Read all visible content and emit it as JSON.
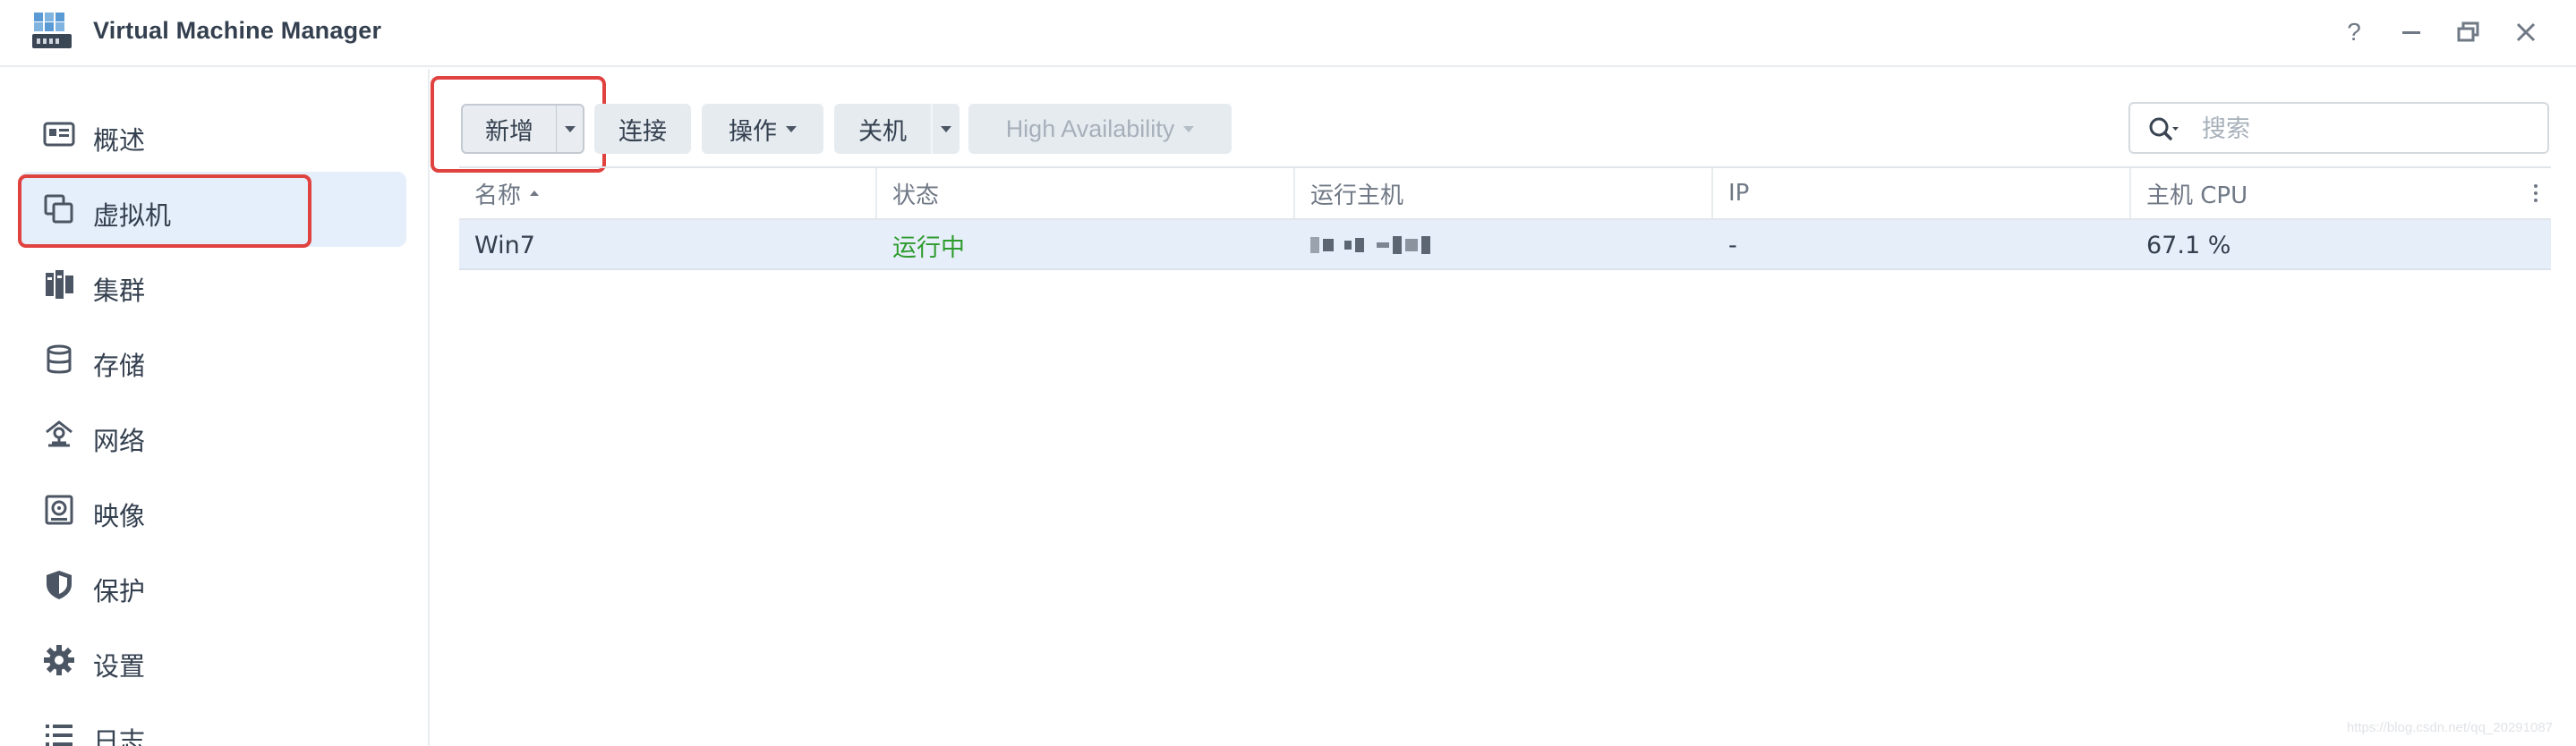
{
  "app": {
    "title": "Virtual Machine Manager",
    "window_buttons": [
      "?",
      "–",
      "❐",
      "✕"
    ]
  },
  "sidebar": {
    "items": [
      {
        "label": "概述",
        "icon": "overview-icon"
      },
      {
        "label": "虚拟机",
        "icon": "virtual-machine-icon",
        "active": true
      },
      {
        "label": "集群",
        "icon": "cluster-icon"
      },
      {
        "label": "存储",
        "icon": "storage-icon"
      },
      {
        "label": "网络",
        "icon": "network-icon"
      },
      {
        "label": "映像",
        "icon": "image-icon"
      },
      {
        "label": "保护",
        "icon": "shield-icon"
      },
      {
        "label": "设置",
        "icon": "gear-icon"
      },
      {
        "label": "日志",
        "icon": "log-list-icon"
      }
    ]
  },
  "toolbar": {
    "add_label": "新增",
    "connect_label": "连接",
    "action_label": "操作",
    "shutdown_label": "关机",
    "ha_label": "High Availability"
  },
  "search": {
    "placeholder": "搜索",
    "value": ""
  },
  "grid": {
    "columns": [
      "名称",
      "状态",
      "运行主机",
      "IP",
      "主机 CPU"
    ],
    "sort_column": "名称",
    "rows": [
      {
        "name": "Win7",
        "status": "运行中",
        "host": "",
        "ip": "-",
        "cpu": "67.1 %"
      }
    ]
  },
  "watermark": "https://blog.csdn.net/qq_20291087",
  "colors": {
    "highlight": "#e0423f",
    "running": "#2e9b2e",
    "selected_row": "#e6eef9",
    "active_nav": "#e5eefb"
  }
}
